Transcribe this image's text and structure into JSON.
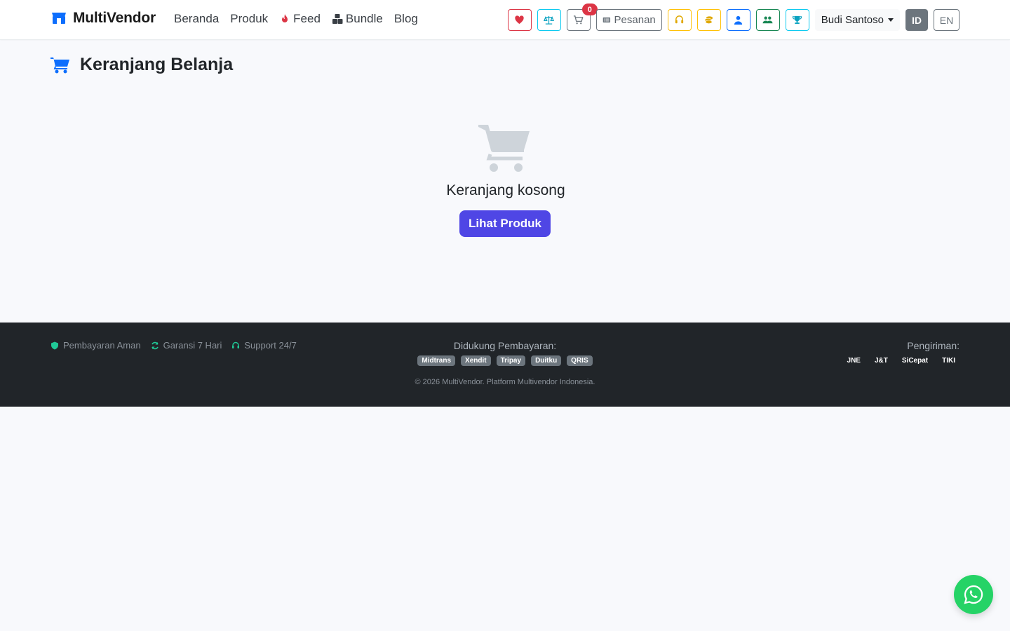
{
  "brand": {
    "name": "MultiVendor"
  },
  "nav": {
    "links": [
      {
        "label": "Beranda",
        "icon": ""
      },
      {
        "label": "Produk",
        "icon": ""
      },
      {
        "label": "Feed",
        "icon": "fire-icon"
      },
      {
        "label": "Bundle",
        "icon": "boxes-icon"
      },
      {
        "label": "Blog",
        "icon": ""
      }
    ],
    "icons": [
      "heart-icon",
      "scale-icon",
      "cart-icon",
      "orders-icon",
      "headset-icon",
      "coins-icon",
      "user-icon",
      "users-icon",
      "trophy-icon"
    ],
    "cart_count": "0",
    "orders_label": "Pesanan",
    "user_name": "Budi Santoso",
    "lang_active": "ID",
    "lang_other": "EN"
  },
  "page": {
    "title": "Keranjang Belanja",
    "empty_message": "Keranjang kosong",
    "cta_label": "Lihat Produk"
  },
  "footer": {
    "features": [
      {
        "label": "Pembayaran Aman",
        "icon": "shield-icon"
      },
      {
        "label": "Garansi 7 Hari",
        "icon": "refresh-icon"
      },
      {
        "label": "Support 24/7",
        "icon": "headset-icon"
      }
    ],
    "payment_label": "Didukung Pembayaran:",
    "payment_methods": [
      "Midtrans",
      "Xendit",
      "Tripay",
      "Duitku",
      "QRIS"
    ],
    "copyright": "© 2026 MultiVendor. Platform Multivendor Indonesia.",
    "shipping_label": "Pengiriman:",
    "shipping_methods": [
      "JNE",
      "J&T",
      "SiCepat",
      "TIKI"
    ]
  },
  "colors": {
    "primary": "#4f46e5",
    "brand_blue": "#0d6efd",
    "footer_bg": "#212529",
    "whatsapp": "#25d366",
    "danger": "#dc3545"
  }
}
